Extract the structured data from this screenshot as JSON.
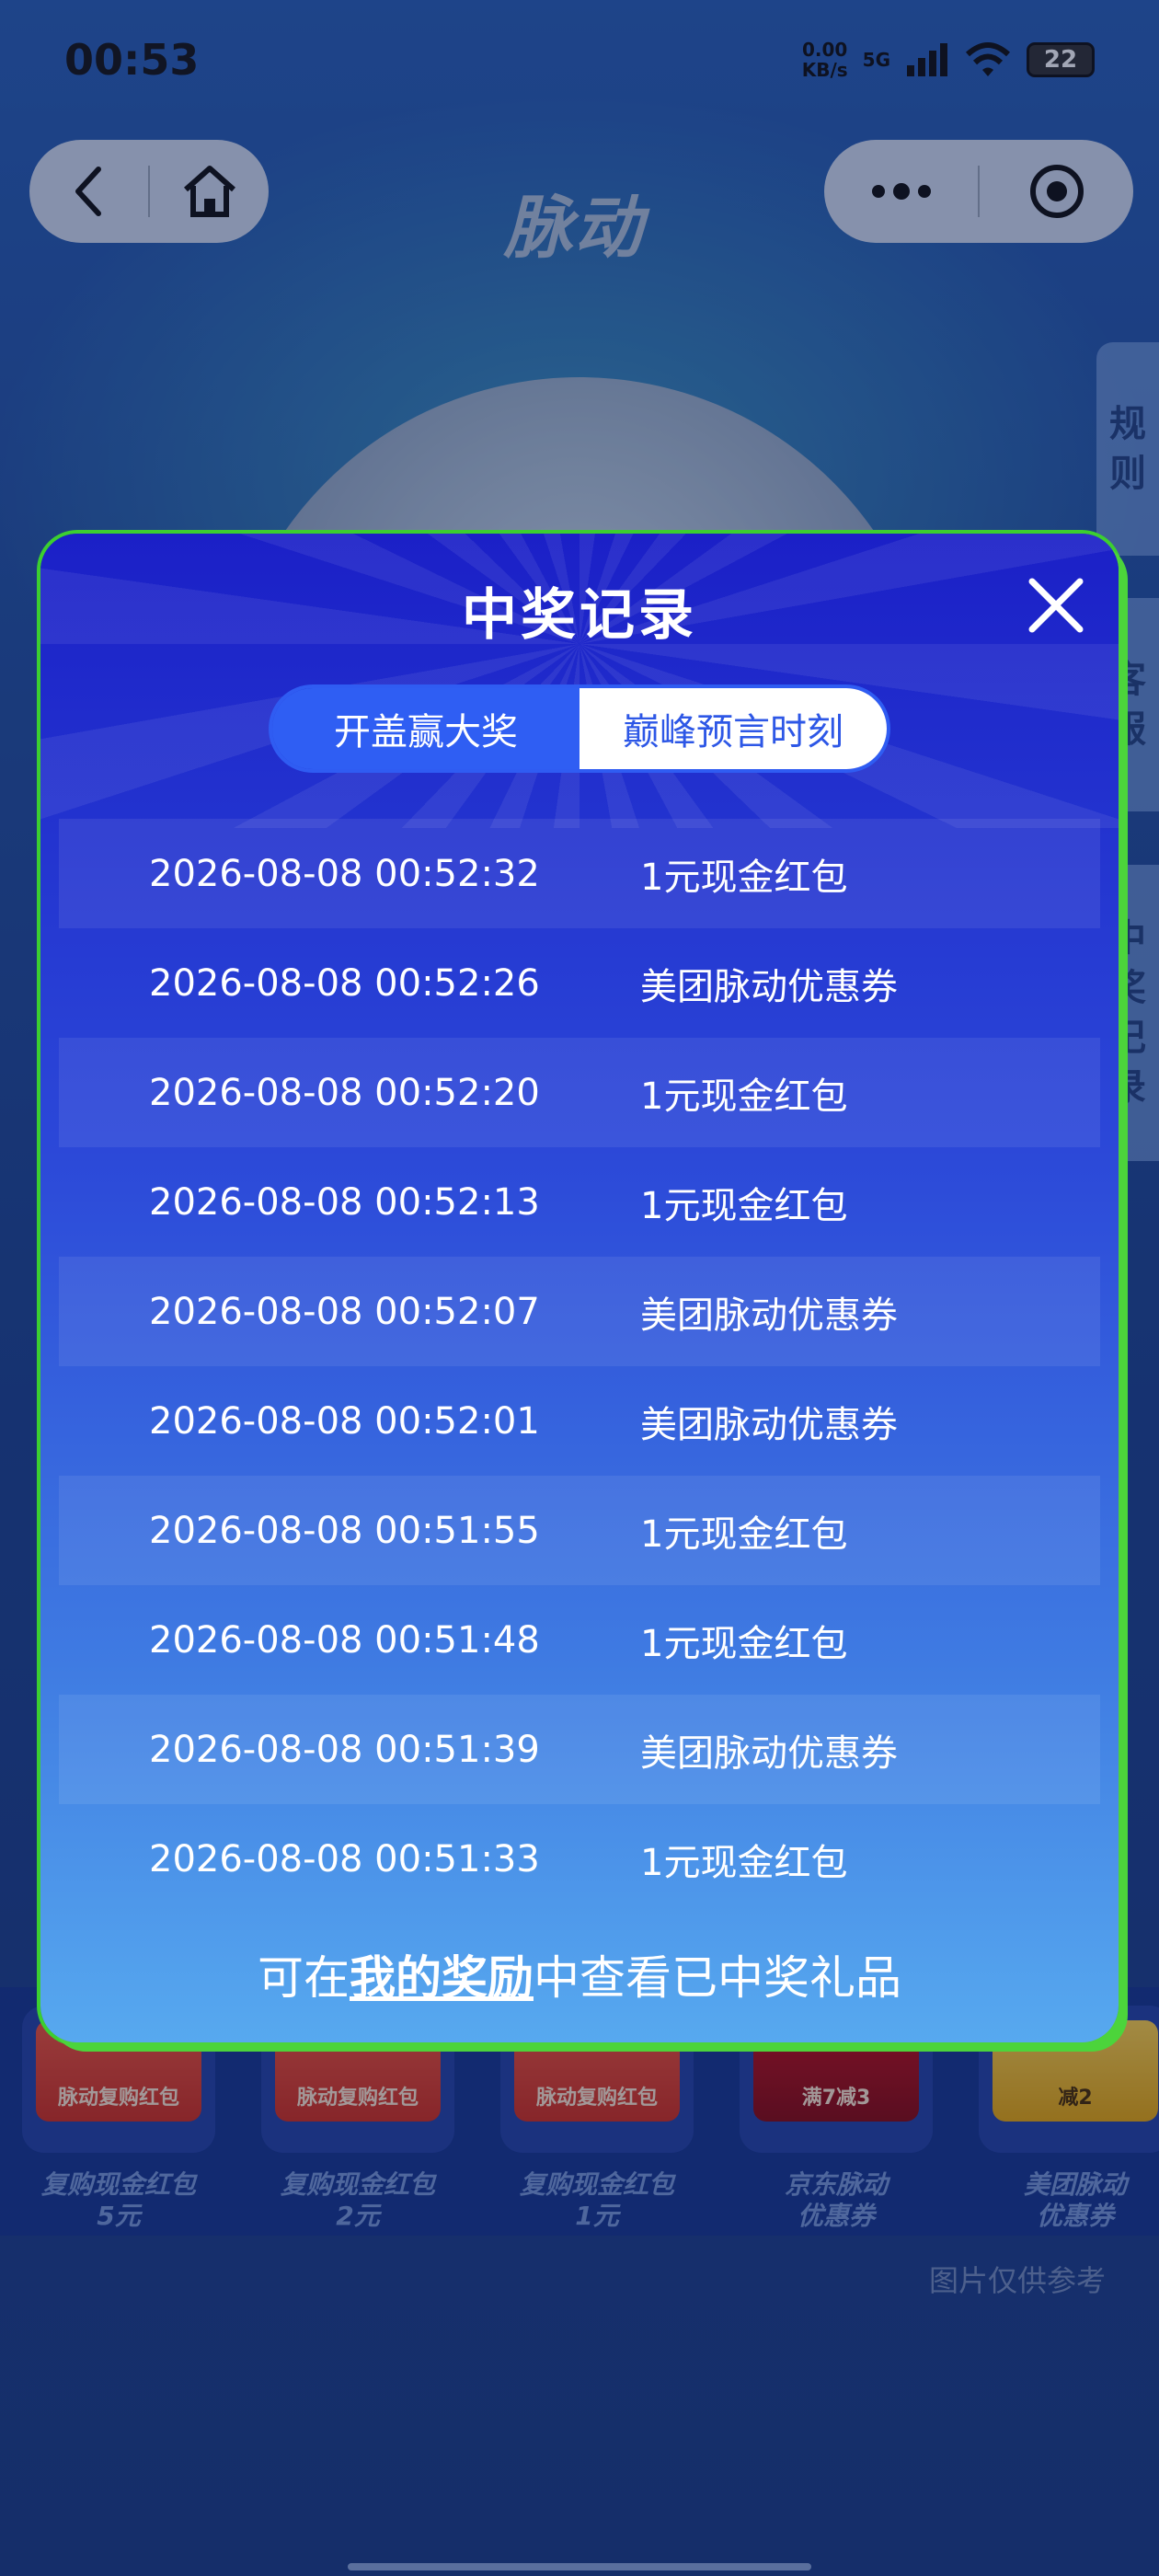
{
  "status_bar": {
    "time": "00:53",
    "net_speed_value": "0.00",
    "net_speed_unit": "KB/s",
    "network": "5G",
    "battery": "22"
  },
  "header": {
    "brand": "脉动"
  },
  "side_tabs": {
    "rules": [
      "规",
      "则"
    ],
    "service": [
      "客",
      "服"
    ],
    "records": [
      "中",
      "奖",
      "记",
      "录"
    ]
  },
  "goods": [
    {
      "ticket": "脉动复购红包",
      "label_line1": "复购现金红包",
      "label_line2": "5元"
    },
    {
      "ticket": "脉动复购红包",
      "label_line1": "复购现金红包",
      "label_line2": "2元"
    },
    {
      "ticket": "脉动复购红包",
      "label_line1": "复购现金红包",
      "label_line2": "1元"
    },
    {
      "ticket": "满7减3",
      "label_line1": "京东脉动",
      "label_line2": "优惠券"
    },
    {
      "ticket": "减2",
      "label_line1": "美团脉动",
      "label_line2": "优惠券"
    }
  ],
  "disclaimer": "图片仅供参考",
  "modal": {
    "title": "中奖记录",
    "tabs": [
      {
        "label": "开盖赢大奖",
        "active": true
      },
      {
        "label": "巅峰预言时刻",
        "active": false
      }
    ],
    "records": [
      {
        "time": "2026-08-08 00:52:32",
        "prize": "1元现金红包"
      },
      {
        "time": "2026-08-08 00:52:26",
        "prize": "美团脉动优惠券"
      },
      {
        "time": "2026-08-08 00:52:20",
        "prize": "1元现金红包"
      },
      {
        "time": "2026-08-08 00:52:13",
        "prize": "1元现金红包"
      },
      {
        "time": "2026-08-08 00:52:07",
        "prize": "美团脉动优惠券"
      },
      {
        "time": "2026-08-08 00:52:01",
        "prize": "美团脉动优惠券"
      },
      {
        "time": "2026-08-08 00:51:55",
        "prize": "1元现金红包"
      },
      {
        "time": "2026-08-08 00:51:48",
        "prize": "1元现金红包"
      },
      {
        "time": "2026-08-08 00:51:39",
        "prize": "美团脉动优惠券"
      },
      {
        "time": "2026-08-08 00:51:33",
        "prize": "1元现金红包"
      }
    ],
    "footer": {
      "prefix": "可在",
      "link": "我的奖励",
      "suffix": "中查看已中奖礼品"
    }
  }
}
